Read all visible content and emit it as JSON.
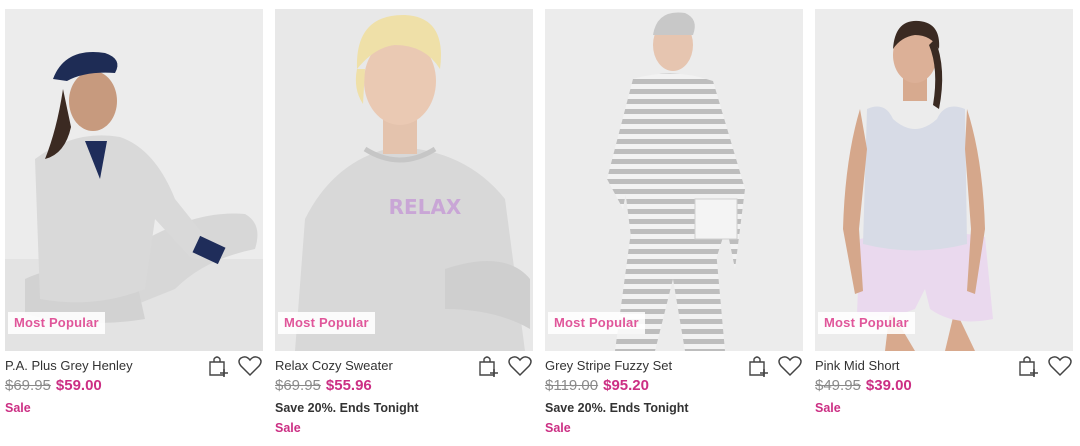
{
  "products": [
    {
      "name": "P.A. Plus Grey Henley",
      "badge": "Most Popular",
      "was_price": "$69.95",
      "price": "$59.00",
      "promo": "",
      "sale": "Sale"
    },
    {
      "name": "Relax Cozy Sweater",
      "badge": "Most Popular",
      "was_price": "$69.95",
      "price": "$55.96",
      "promo": "Save 20%. Ends Tonight",
      "sale": "Sale",
      "print_text": "RELAX"
    },
    {
      "name": "Grey Stripe Fuzzy Set",
      "badge": "Most Popular",
      "was_price": "$119.00",
      "price": "$95.20",
      "promo": "Save 20%. Ends Tonight",
      "sale": "Sale"
    },
    {
      "name": "Pink Mid Short",
      "badge": "Most Popular",
      "was_price": "$49.95",
      "price": "$39.00",
      "promo": "",
      "sale": "Sale"
    }
  ],
  "icons": {
    "add_to_bag": "bag-plus-icon",
    "wishlist": "heart-icon"
  },
  "colors": {
    "accent_pink": "#cc2f84",
    "badge_pink": "#e0569a",
    "strike_grey": "#8a8a8a"
  }
}
